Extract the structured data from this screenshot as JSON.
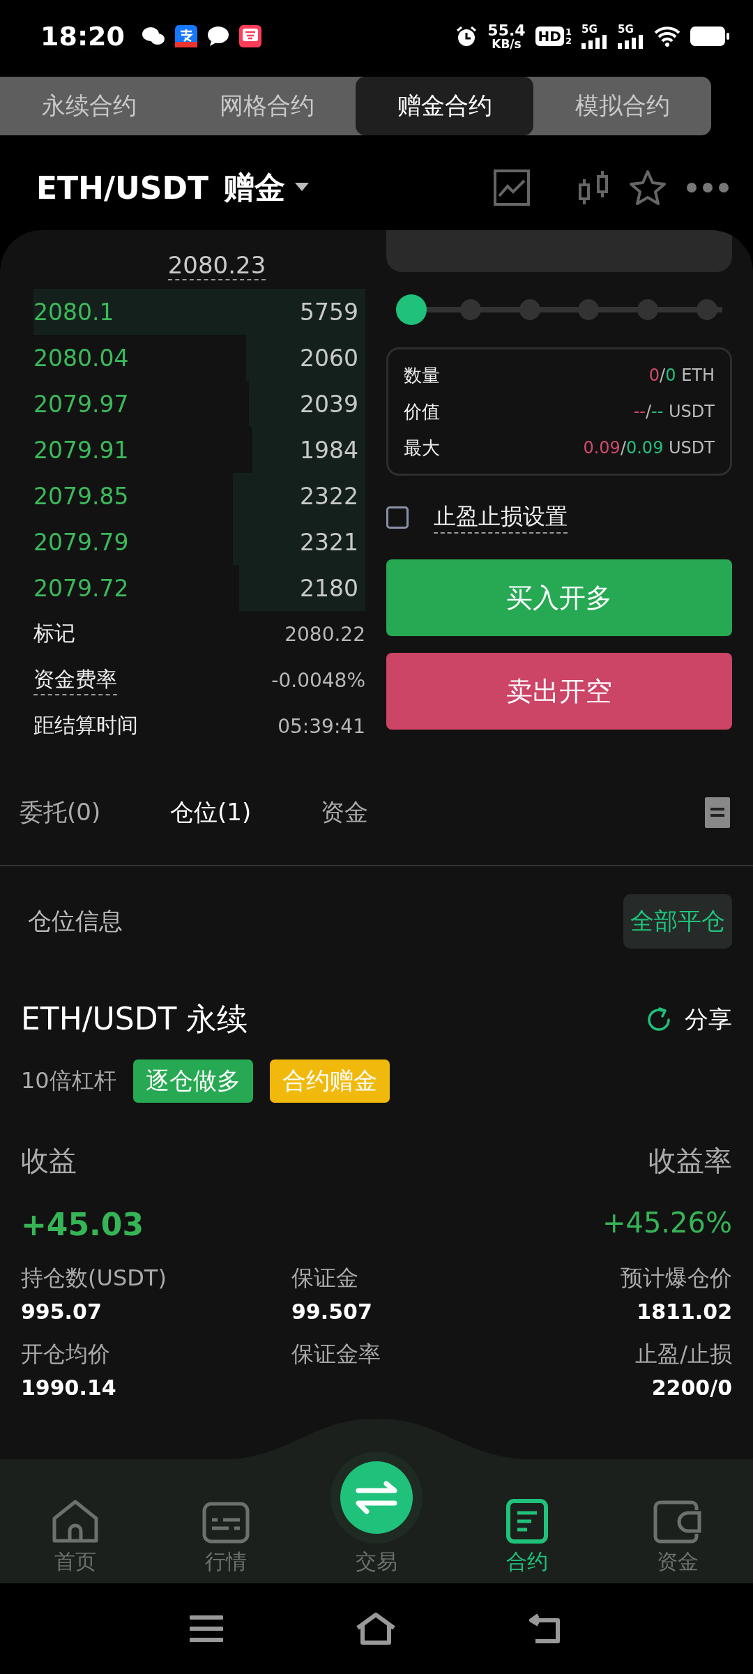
{
  "status_bar": {
    "time": "18:20",
    "speed": "55.4",
    "speed_unit": "KB/s",
    "hd": "HD",
    "hd_sub": [
      "1",
      "2"
    ],
    "signals": [
      "5G",
      "5G"
    ]
  },
  "mode_tabs": [
    {
      "label": "永续合约",
      "selected": false
    },
    {
      "label": "网格合约",
      "selected": false
    },
    {
      "label": "赠金合约",
      "selected": true
    },
    {
      "label": "模拟合约",
      "selected": false
    }
  ],
  "header": {
    "pair": "ETH/USDT",
    "mode": "赠金"
  },
  "order_book": {
    "last_price": "2080.23",
    "rows": [
      {
        "price": "2080.1",
        "amount": "5759"
      },
      {
        "price": "2080.04",
        "amount": "2060"
      },
      {
        "price": "2079.97",
        "amount": "2039"
      },
      {
        "price": "2079.91",
        "amount": "1984"
      },
      {
        "price": "2079.85",
        "amount": "2322"
      },
      {
        "price": "2079.79",
        "amount": "2321"
      },
      {
        "price": "2079.72",
        "amount": "2180"
      }
    ]
  },
  "market_info": [
    {
      "label": "标记",
      "value": "2080.22",
      "dotted": false
    },
    {
      "label": "资金费率",
      "value": "-0.0048%",
      "dotted": true
    },
    {
      "label": "距结算时间",
      "value": "05:39:41",
      "dotted": false
    }
  ],
  "slider": {
    "level": 0
  },
  "summary": [
    {
      "label": "数量",
      "sell": "0",
      "separator": "/",
      "buy": "0",
      "unit": "ETH"
    },
    {
      "label": "价值",
      "sell": "--",
      "separator": "/",
      "buy": "--",
      "unit": "USDT"
    },
    {
      "label": "最大",
      "sell": "0.09",
      "separator": "/",
      "buy": "0.09",
      "unit": "USDT"
    }
  ],
  "tp_sl": {
    "label": "止盈止损设置",
    "checked": false
  },
  "buy_button": "买入开多",
  "sell_button": "卖出开空",
  "bottom_tabs": [
    {
      "label": "委托(0)",
      "selected": false
    },
    {
      "label": "仓位(1)",
      "selected": true
    },
    {
      "label": "资金",
      "selected": false
    }
  ],
  "position_section": {
    "title": "仓位信息",
    "close_all": "全部平仓"
  },
  "position": {
    "symbol": "ETH/USDT 永续",
    "share": "分享",
    "leverage": "10倍杠杆",
    "tags": [
      {
        "label": "逐仓做多",
        "color": "#27a852"
      },
      {
        "label": "合约赠金",
        "color": "#f0b90b"
      }
    ],
    "pnl_label": "收益",
    "pnl": "+45.03",
    "roe_label": "收益率",
    "roe": "+45.26%",
    "stats": [
      {
        "label": "持仓数(USDT)",
        "value": "995.07"
      },
      {
        "label": "保证金",
        "value": "99.507"
      },
      {
        "label": "预计爆仓价",
        "value": "1811.02"
      },
      {
        "label": "开仓均价",
        "value": "1990.14"
      },
      {
        "label": "保证金率"
      },
      {
        "label": "止盈/止损",
        "value": "2200/0"
      }
    ]
  },
  "nav": [
    {
      "label": "首页",
      "kind": "home",
      "selected": false
    },
    {
      "label": "行情",
      "kind": "market",
      "selected": false
    },
    {
      "label": "交易",
      "kind": "trade",
      "selected": false
    },
    {
      "label": "合约",
      "kind": "contract",
      "selected": true
    },
    {
      "label": "资金",
      "kind": "wallet",
      "selected": false
    }
  ]
}
